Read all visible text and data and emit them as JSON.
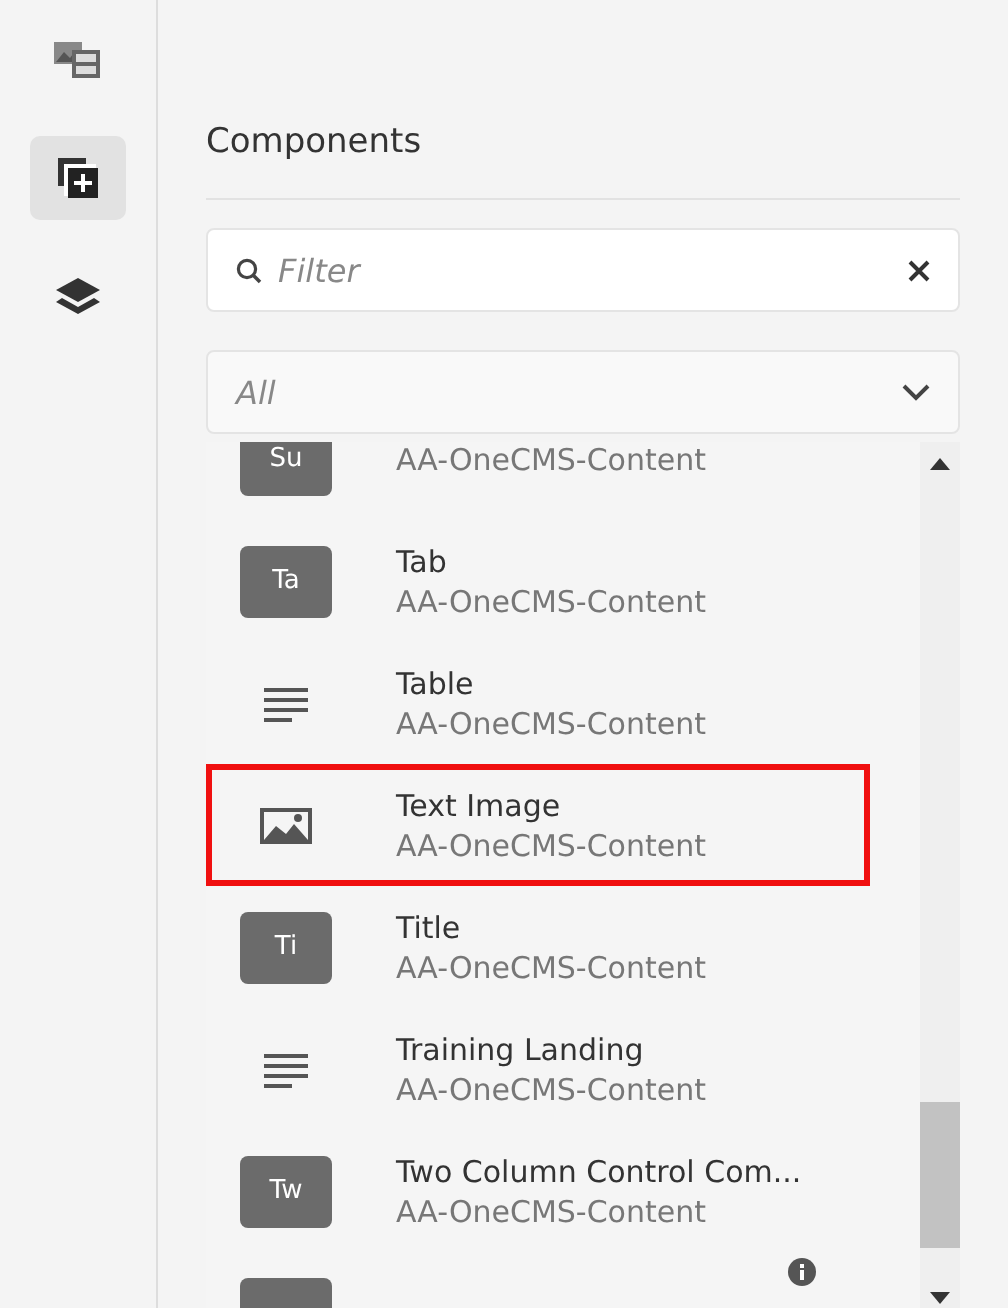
{
  "rail": {
    "items": [
      {
        "kind": "media",
        "selected": false
      },
      {
        "kind": "add",
        "selected": true
      },
      {
        "kind": "layers",
        "selected": false
      }
    ]
  },
  "panel": {
    "title": "Components",
    "filter": {
      "placeholder": "Filter"
    },
    "group_select": {
      "value": "All"
    },
    "items": [
      {
        "kind": "badge",
        "badge": "Su",
        "subtitle": "AA-OneCMS-Content",
        "highlighted": false
      },
      {
        "kind": "badge",
        "badge": "Ta",
        "title": "Tab",
        "subtitle": "AA-OneCMS-Content",
        "highlighted": false
      },
      {
        "kind": "lines",
        "title": "Table",
        "subtitle": "AA-OneCMS-Content",
        "highlighted": false
      },
      {
        "kind": "image",
        "title": "Text Image",
        "subtitle": "AA-OneCMS-Content",
        "highlighted": true
      },
      {
        "kind": "badge",
        "badge": "Ti",
        "title": "Title",
        "subtitle": "AA-OneCMS-Content",
        "highlighted": false
      },
      {
        "kind": "lines",
        "title": "Training Landing",
        "subtitle": "AA-OneCMS-Content",
        "highlighted": false
      },
      {
        "kind": "badge",
        "badge": "Tw",
        "title": "Two Column Control Com...",
        "subtitle": "AA-OneCMS-Content",
        "highlighted": false
      },
      {
        "kind": "badge",
        "info": true,
        "highlighted": false
      }
    ]
  }
}
